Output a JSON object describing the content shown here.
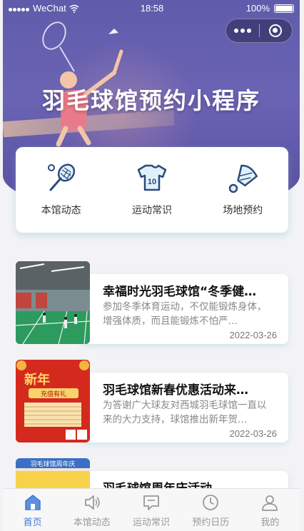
{
  "status_bar": {
    "carrier": "WeChat",
    "time": "18:58",
    "battery": "100%"
  },
  "banner": {
    "title": "羽毛球馆预约小程序"
  },
  "nav": [
    {
      "label": "本馆动态",
      "icon": "racket-icon"
    },
    {
      "label": "运动常识",
      "icon": "jersey-icon"
    },
    {
      "label": "场地预约",
      "icon": "shuttlecock-icon"
    }
  ],
  "news": [
    {
      "title": "幸福时光羽毛球馆“冬季健…",
      "desc": "参加冬季体育运动，不仅能锻炼身体，增强体质，而且能锻炼不怕严…",
      "date": "2022-03-26"
    },
    {
      "title": "羽毛球馆新春优惠活动来…",
      "desc": "为答谢广大球友对西城羽毛球馆一直以来的大力支持，球馆推出新年贺…",
      "date": "2022-03-26",
      "thumb_text": {
        "headline": "新年",
        "sub": "充值有礼"
      }
    },
    {
      "title": "羽毛球馆周年庆活动",
      "desc": "",
      "date": "",
      "thumb_text": {
        "headline": "羽毛球馆周年庆"
      }
    }
  ],
  "tabs": [
    {
      "label": "首页",
      "icon": "home-icon",
      "active": true
    },
    {
      "label": "本馆动态",
      "icon": "speaker-icon",
      "active": false
    },
    {
      "label": "运动常识",
      "icon": "message-icon",
      "active": false
    },
    {
      "label": "预约日历",
      "icon": "clock-icon",
      "active": false
    },
    {
      "label": "我的",
      "icon": "user-icon",
      "active": false
    }
  ],
  "colors": {
    "banner": "#5f5cab",
    "accent": "#3d7bd8",
    "card_shadow": "#8cc8dc"
  }
}
